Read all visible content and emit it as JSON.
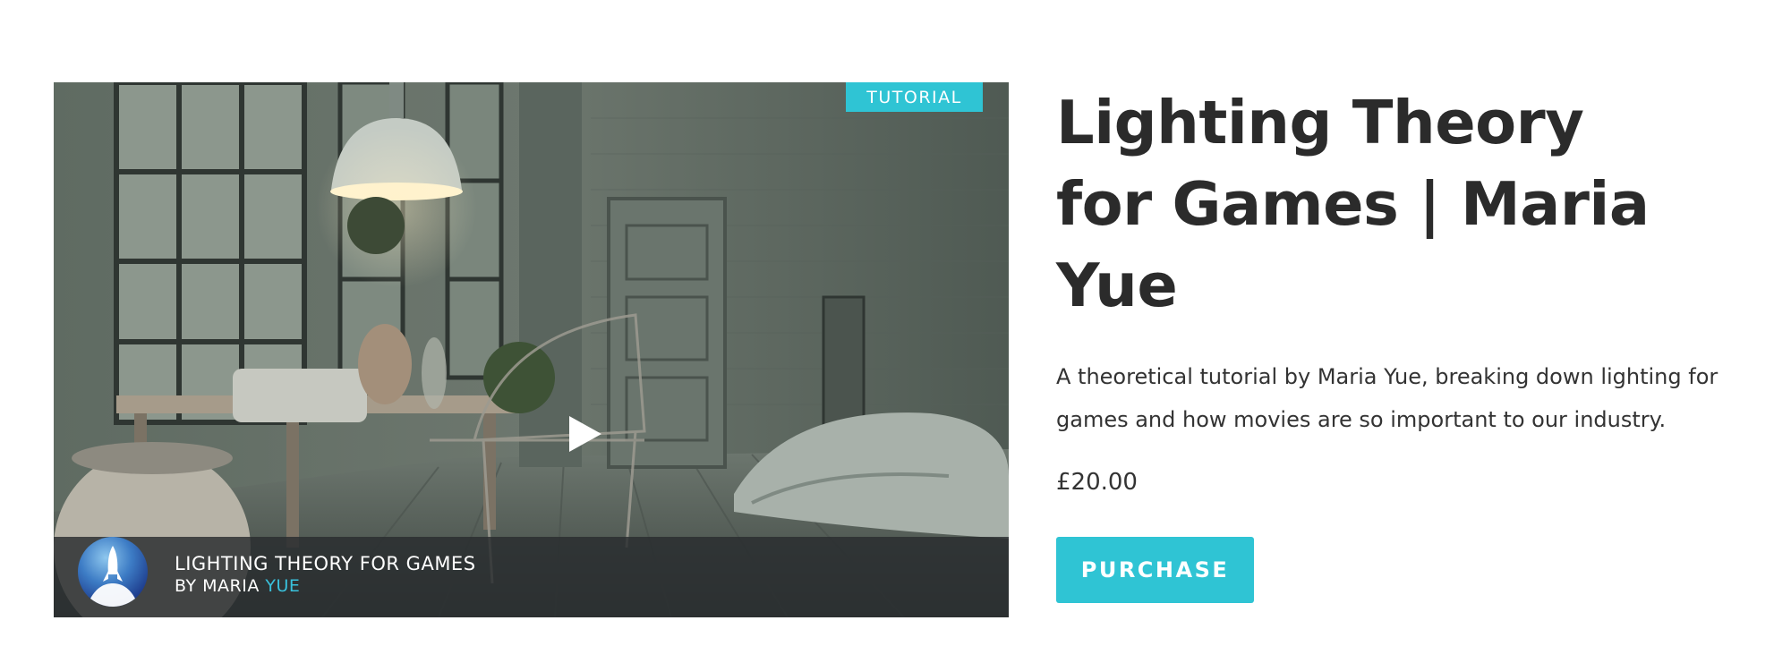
{
  "product": {
    "badge": "TUTORIAL",
    "title": "Lighting Theory for Games | Maria Yue",
    "description": "A theoretical tutorial by Maria Yue, breaking down lighting for games and how movies are so important to our industry.",
    "price": "£20.00",
    "purchase_label": "PURCHASE"
  },
  "video": {
    "caption_title": "LIGHTING THEORY FOR GAMES",
    "caption_by": "BY MARIA",
    "caption_name_accent": "YUE"
  },
  "colors": {
    "accent": "#2fc4d4",
    "text": "#2b2b2b"
  },
  "icons": {
    "play": "play-icon",
    "logo": "rocket-logo-icon"
  }
}
